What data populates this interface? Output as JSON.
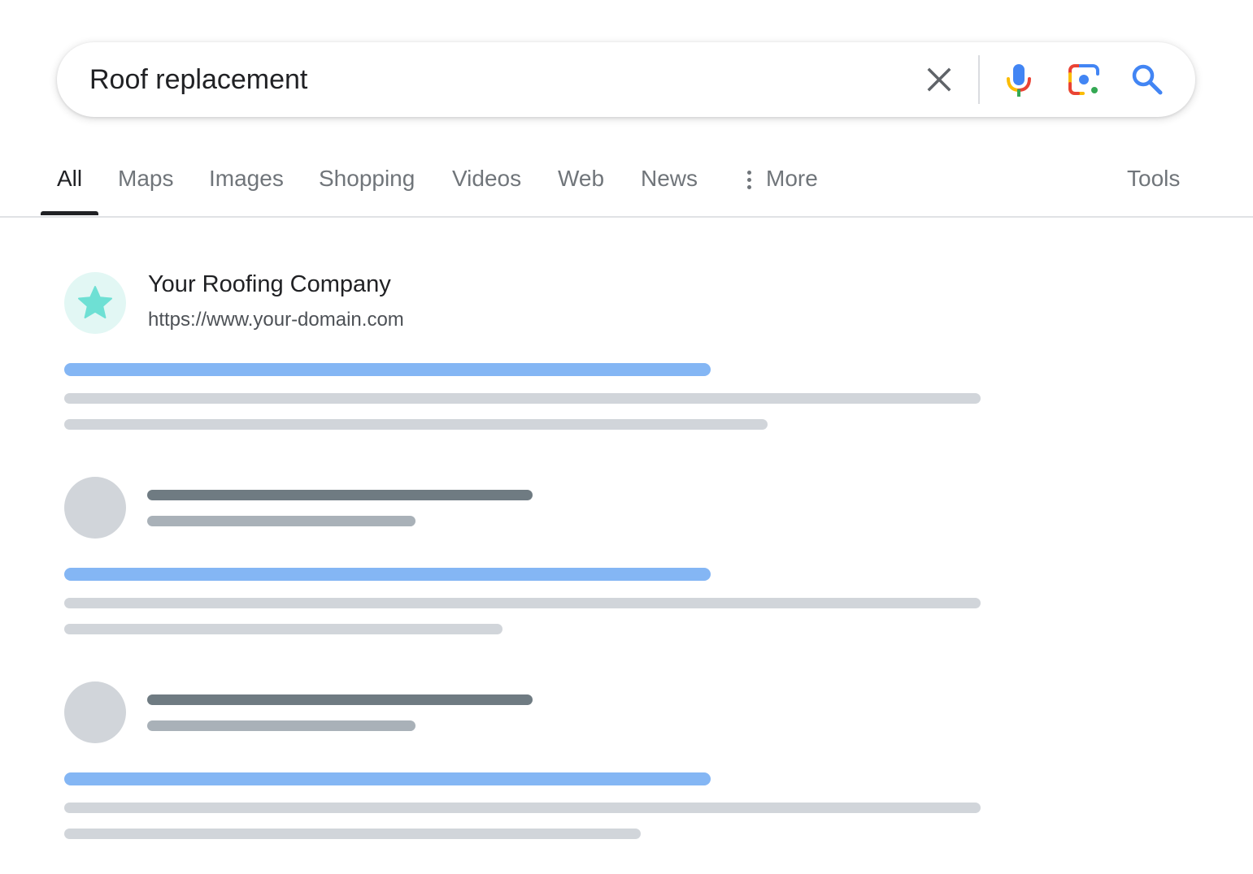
{
  "search": {
    "query": "Roof replacement",
    "clear_icon": "close-icon",
    "voice_icon": "microphone-icon",
    "lens_icon": "camera-lens-icon",
    "search_icon": "search-icon"
  },
  "tabs": {
    "items": [
      {
        "label": "All",
        "active": true
      },
      {
        "label": "Maps",
        "active": false
      },
      {
        "label": "Images",
        "active": false
      },
      {
        "label": "Shopping",
        "active": false
      },
      {
        "label": "Videos",
        "active": false
      },
      {
        "label": "Web",
        "active": false
      },
      {
        "label": "News",
        "active": false
      },
      {
        "label": "More",
        "active": false
      }
    ],
    "tools_label": "Tools"
  },
  "results": [
    {
      "site_name": "Your Roofing Company",
      "url": "https://www.your-domain.com",
      "favicon_icon": "star-icon",
      "featured": true
    },
    {
      "placeholder": true
    },
    {
      "placeholder": true
    }
  ],
  "colors": {
    "accent_blue": "#84b6f4",
    "favicon_star": "#6ee0d4",
    "placeholder_gray": "#d1d5da"
  }
}
